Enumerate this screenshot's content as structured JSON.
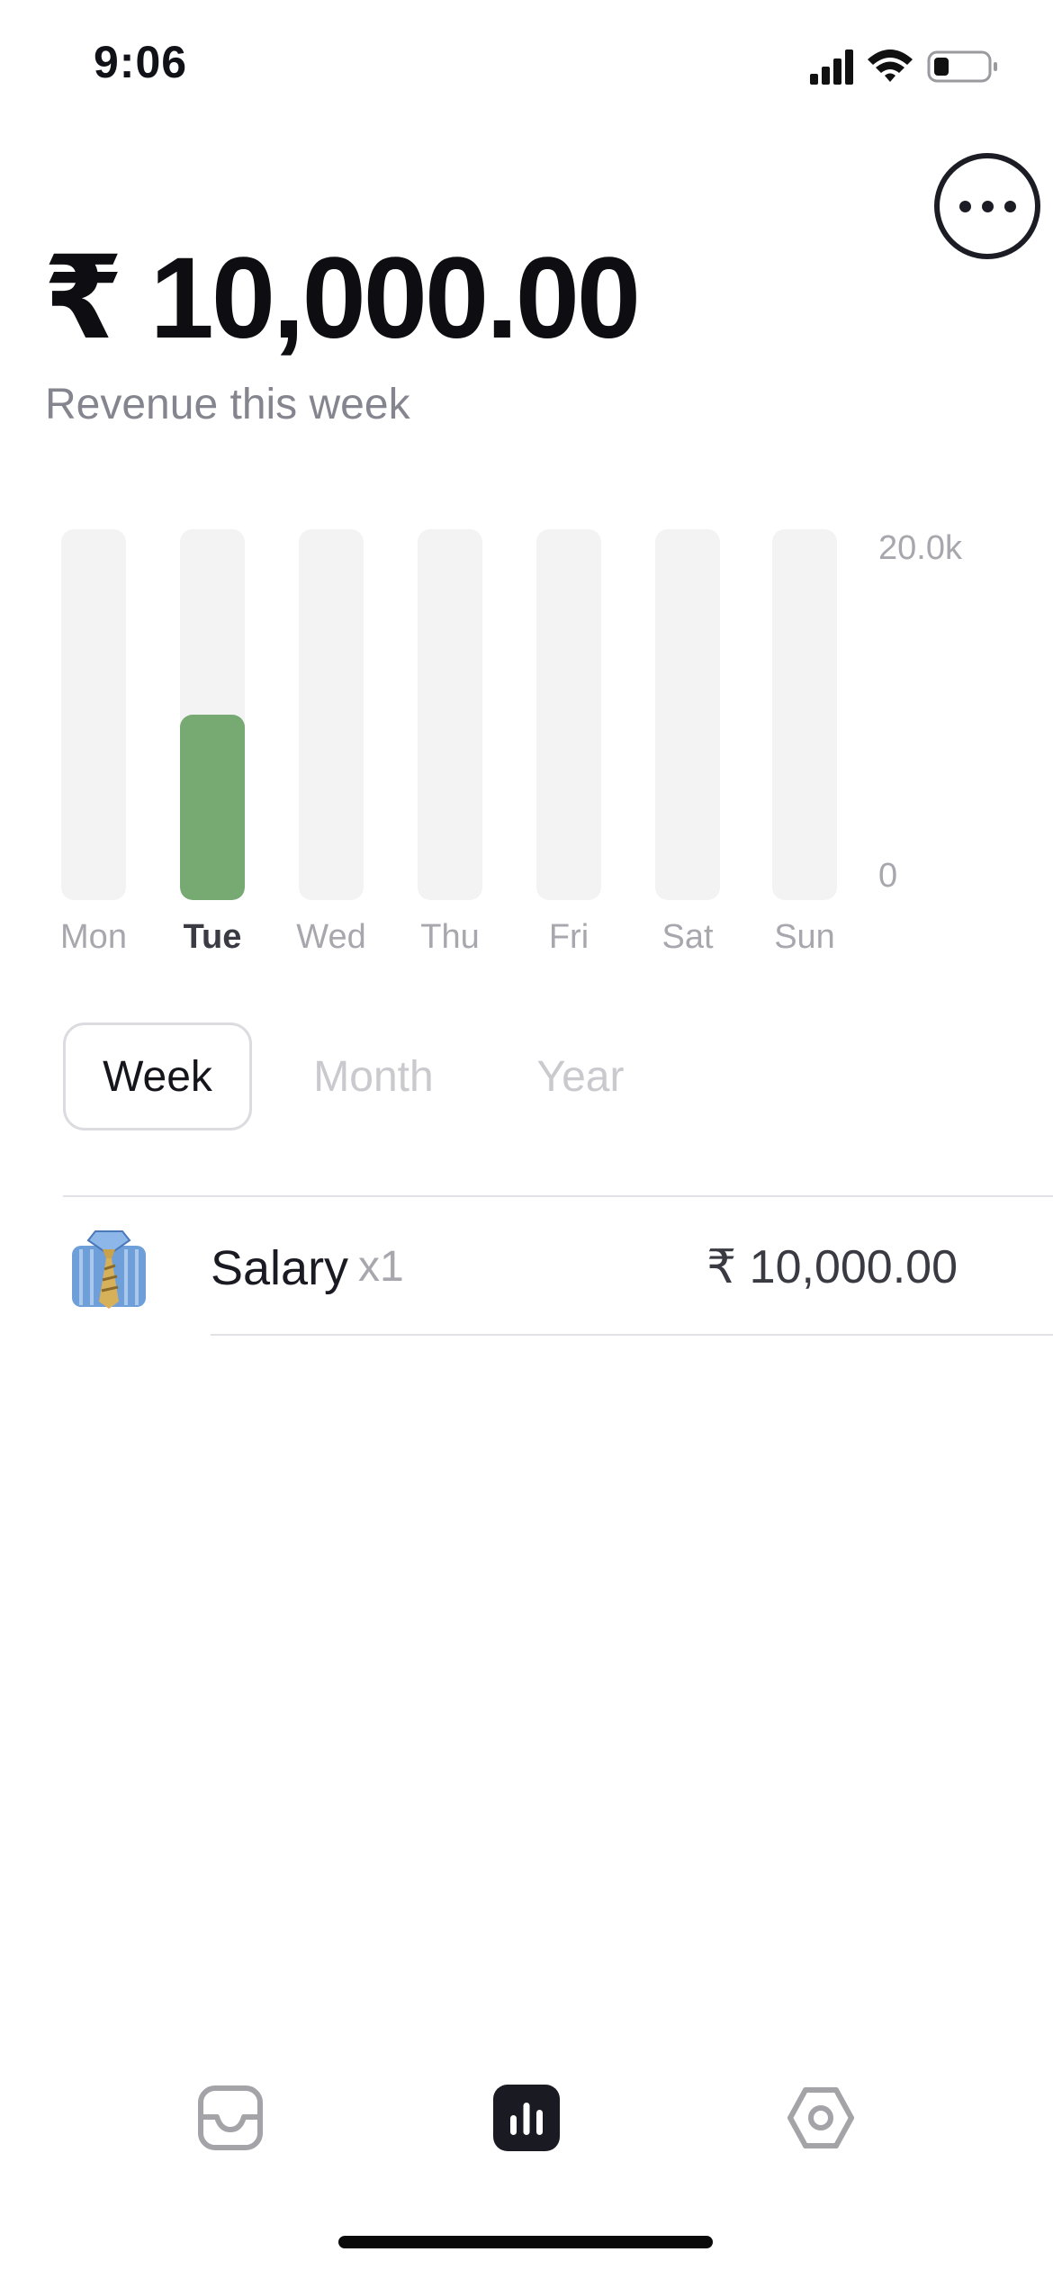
{
  "status_bar": {
    "time": "9:06"
  },
  "header": {
    "amount": "₹ 10,000.00",
    "subtitle": "Revenue this week"
  },
  "chart_data": {
    "type": "bar",
    "categories": [
      "Mon",
      "Tue",
      "Wed",
      "Thu",
      "Fri",
      "Sat",
      "Sun"
    ],
    "values": [
      0,
      10000,
      0,
      0,
      0,
      0,
      0
    ],
    "ylim": [
      0,
      20000
    ],
    "y_ticks": [
      "20.0k",
      "0"
    ],
    "active_category": "Tue",
    "bar_color": "#77a972"
  },
  "tabs": [
    {
      "label": "Week",
      "active": true
    },
    {
      "label": "Month",
      "active": false
    },
    {
      "label": "Year",
      "active": false
    }
  ],
  "transactions": [
    {
      "icon": "necktie-shirt-icon",
      "name": "Salary",
      "qty": "x1",
      "amount": "₹ 10,000.00"
    }
  ],
  "nav": {
    "items": [
      {
        "icon": "inbox-icon",
        "active": false
      },
      {
        "icon": "stats-icon",
        "active": true
      },
      {
        "icon": "settings-icon",
        "active": false
      }
    ]
  }
}
